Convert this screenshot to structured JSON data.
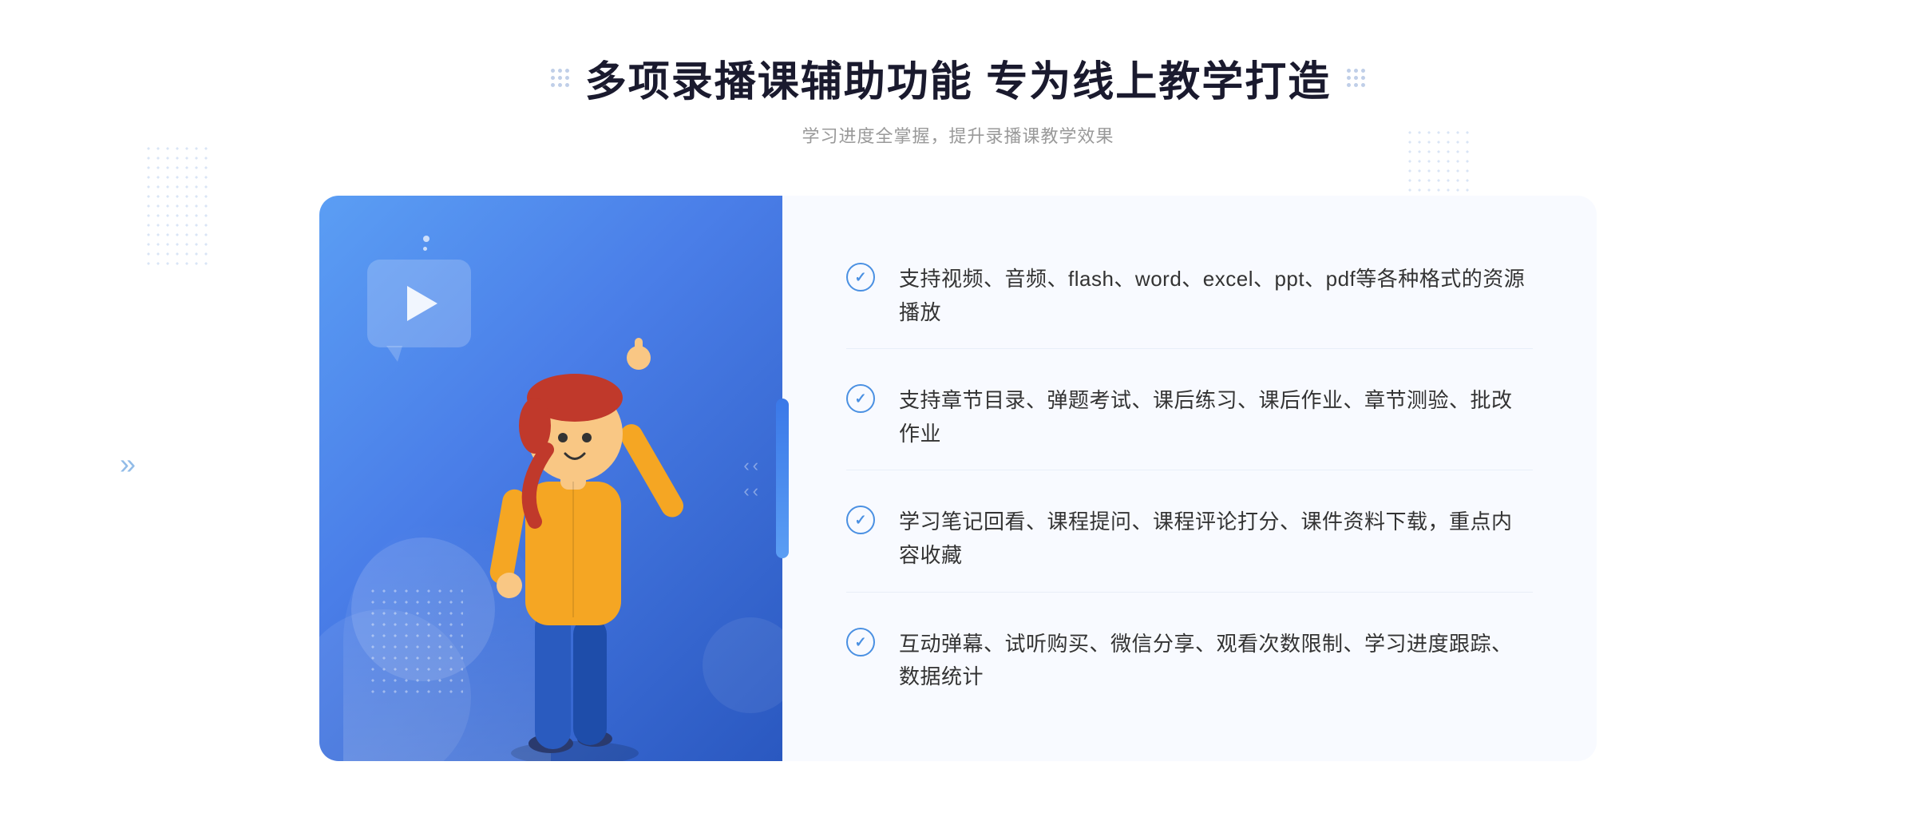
{
  "header": {
    "title": "多项录播课辅助功能 专为线上教学打造",
    "subtitle": "学习进度全掌握，提升录播课教学效果",
    "title_dots_left": "⁙",
    "title_dots_right": "⁙"
  },
  "features": [
    {
      "id": 1,
      "text": "支持视频、音频、flash、word、excel、ppt、pdf等各种格式的资源播放"
    },
    {
      "id": 2,
      "text": "支持章节目录、弹题考试、课后练习、课后作业、章节测验、批改作业"
    },
    {
      "id": 3,
      "text": "学习笔记回看、课程提问、课程评论打分、课件资料下载，重点内容收藏"
    },
    {
      "id": 4,
      "text": "互动弹幕、试听购买、微信分享、观看次数限制、学习进度跟踪、数据统计"
    }
  ],
  "colors": {
    "primary_blue": "#4a90e2",
    "gradient_start": "#5b9ef4",
    "gradient_end": "#2a58c0",
    "text_dark": "#1a1a2e",
    "text_gray": "#999999",
    "text_body": "#333333",
    "bg_light": "#f8faff"
  },
  "icons": {
    "check": "✓",
    "play": "▶",
    "chevron_right": "»",
    "chevron_double": "«"
  }
}
